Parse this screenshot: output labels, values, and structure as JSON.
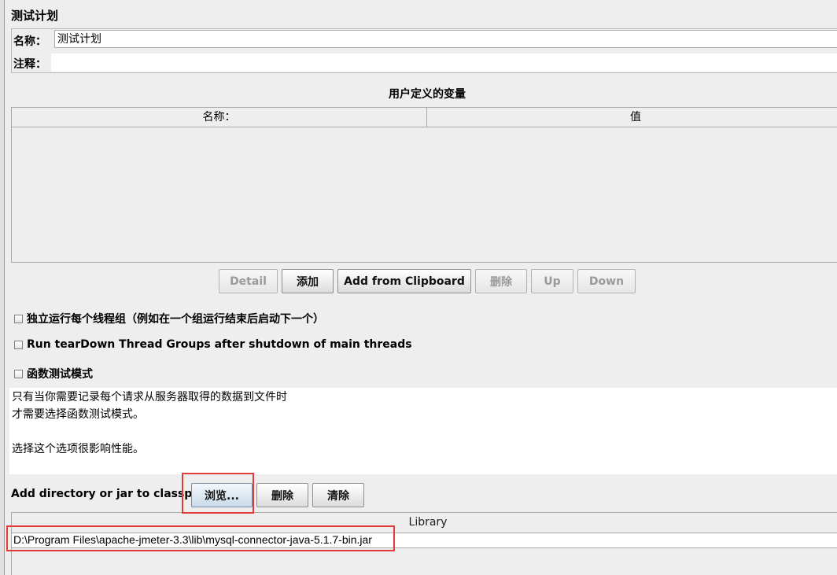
{
  "test_plan": {
    "title": "测试计划",
    "name_label": "名称：",
    "name_value": "测试计划",
    "comment_label": "注释：",
    "comment_value": ""
  },
  "user_variables": {
    "title": "用户定义的变量",
    "columns": [
      "名称：",
      "值"
    ],
    "rows": []
  },
  "variable_buttons": {
    "detail": "Detail",
    "add": "添加",
    "add_from_clipboard": "Add from Clipboard",
    "delete": "删除",
    "up": "Up",
    "down": "Down"
  },
  "options": {
    "serialize_thread_groups": {
      "label": "独立运行每个线程组（例如在一个组运行结束后启动下一个）",
      "checked": false
    },
    "teardown_on_shutdown": {
      "label": "Run tearDown Thread Groups after shutdown of main threads",
      "checked": false
    },
    "functional_mode": {
      "label": "函数测试模式",
      "checked": false
    }
  },
  "functional_mode_description": [
    "只有当你需要记录每个请求从服务器取得的数据到文件时",
    "才需要选择函数测试模式。",
    "",
    "选择这个选项很影响性能。"
  ],
  "classpath": {
    "label": "Add directory or jar to classpath",
    "browse_button": "浏览...",
    "delete_button": "删除",
    "clear_button": "清除",
    "library_header": "Library",
    "libraries": [
      "D:\\Program Files\\apache-jmeter-3.3\\lib\\mysql-connector-java-5.1.7-bin.jar"
    ]
  },
  "colors": {
    "highlight": "#e53a3a",
    "panel_bg": "#eeeeee"
  }
}
